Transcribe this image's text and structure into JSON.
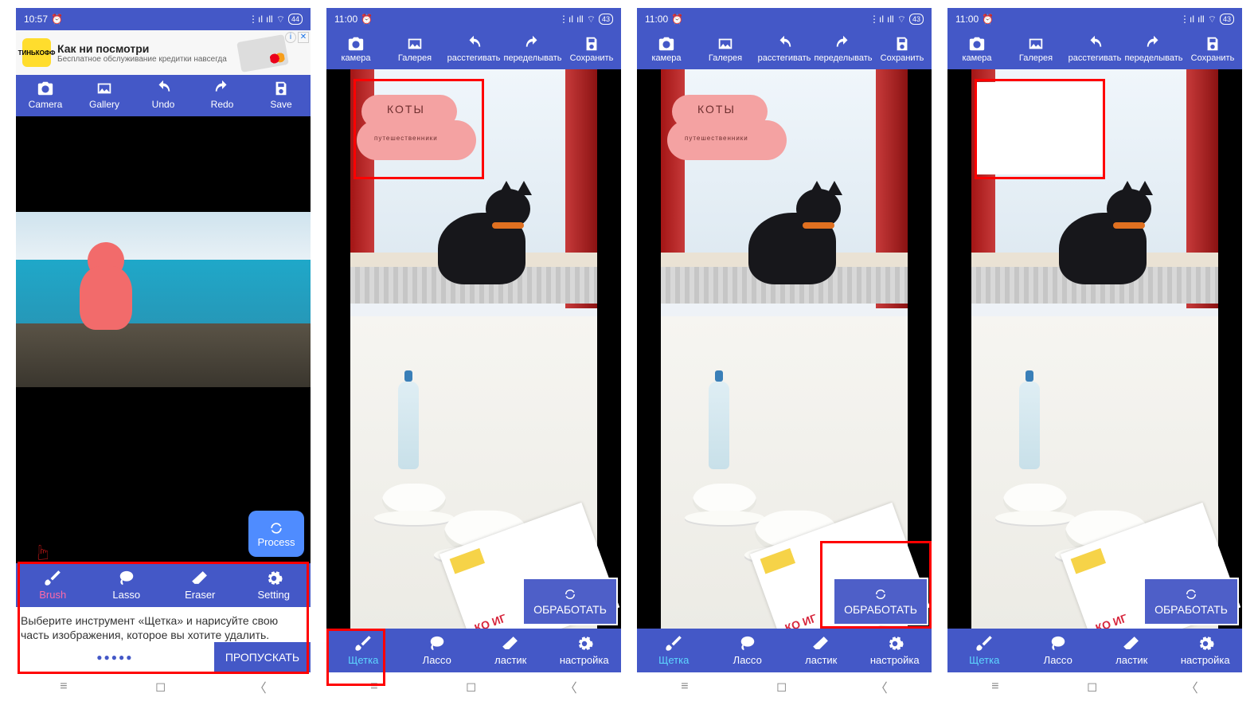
{
  "s1": {
    "time": "10:57",
    "batt": "44",
    "top": {
      "camera": "Camera",
      "gallery": "Gallery",
      "undo": "Undo",
      "redo": "Redo",
      "save": "Save"
    },
    "ad": {
      "title": "Как ни посмотри",
      "line": "Бесплатное обслуживание кредитки навсегда",
      "brand": "ТИНЬКОФФ"
    },
    "process": "Process",
    "bottom": {
      "brush": "Brush",
      "lasso": "Lasso",
      "eraser": "Eraser",
      "setting": "Setting"
    },
    "tip": "Выберите инструмент «Щетка» и нарисуйте свою часть изображения, которое вы хотите удалить.",
    "dots": "●●●●●",
    "skip": "ПРОПУСКАТЬ"
  },
  "ru": {
    "time": "11:00",
    "batt": "43",
    "top": {
      "camera": "камера",
      "gallery": "Галерея",
      "undo": "расстегивать",
      "redo": "переделывать",
      "save": "Сохранить"
    },
    "process": "ОБРАБОТАТЬ",
    "bottom": {
      "brush": "Щетка",
      "lasso": "Лассо",
      "eraser": "ластик",
      "setting": "настройка"
    },
    "mark": {
      "title": "КОТЫ",
      "sub": "путешественники"
    },
    "news": "КО\nИГ"
  }
}
